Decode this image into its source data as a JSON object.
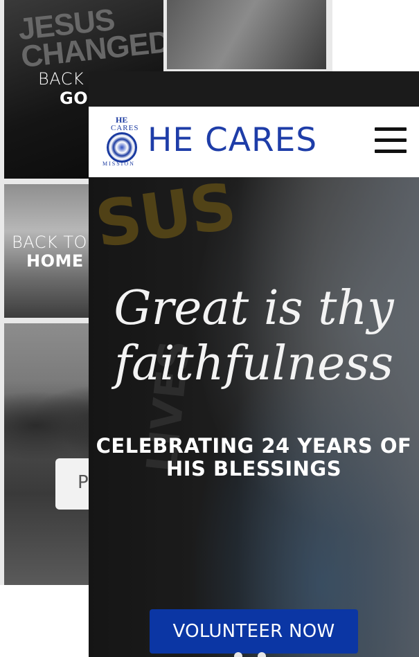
{
  "background_page": {
    "tile_a": {
      "caption_line1": "BACK",
      "caption_line2": "GO"
    },
    "tile_c": {
      "caption_line1": "BACK TO",
      "caption_line2": "HOME"
    },
    "tile_d": {
      "button_label": "P"
    },
    "tile_a_shirt_text": "JESUS\nCHANGED"
  },
  "phone": {
    "header": {
      "logo": {
        "he": "HE",
        "cares": "CARES",
        "mission": "MISSION"
      },
      "brand_title": "HE CARES",
      "menu_icon": "hamburger-menu-icon"
    },
    "hero": {
      "script_title": "Great is thy faithfulness",
      "subtitle": "CELEBRATING 24 YEARS OF HIS BLESSINGS",
      "cta_label": "VOLUNTEER NOW",
      "shirt_text": "SUS",
      "shirt_text_2": "LIVES",
      "carousel_dots": 2
    }
  },
  "colors": {
    "brand_blue": "#1e3da8",
    "cta_blue": "#0b36a4",
    "header_bg": "#ffffff",
    "status_bar_bg": "#1b1b1b"
  }
}
